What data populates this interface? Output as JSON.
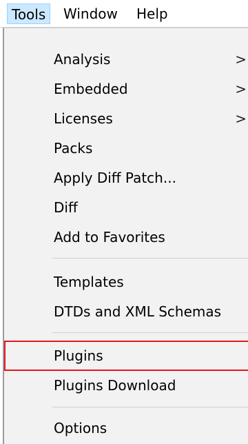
{
  "menubar": {
    "items": [
      {
        "label": "Tools",
        "active": true
      },
      {
        "label": "Window",
        "active": false
      },
      {
        "label": "Help",
        "active": false
      }
    ]
  },
  "dropdown": {
    "items": [
      {
        "label": "Analysis",
        "submenu": true
      },
      {
        "label": "Embedded",
        "submenu": true
      },
      {
        "label": "Licenses",
        "submenu": true
      },
      {
        "label": "Packs",
        "submenu": false
      },
      {
        "label": "Apply Diff Patch...",
        "submenu": false
      },
      {
        "label": "Diff",
        "submenu": false
      },
      {
        "label": "Add to Favorites",
        "submenu": false
      },
      {
        "label": "Templates",
        "submenu": false
      },
      {
        "label": "DTDs and XML Schemas",
        "submenu": false
      },
      {
        "label": "Plugins",
        "submenu": false,
        "highlighted": true
      },
      {
        "label": "Plugins Download",
        "submenu": false
      },
      {
        "label": "Options",
        "submenu": false
      }
    ],
    "submenu_glyph": ">"
  },
  "colors": {
    "menubar_active_bg": "#cce8ff",
    "dropdown_bg": "#f2f2f2",
    "highlight_border": "#e8141b"
  }
}
